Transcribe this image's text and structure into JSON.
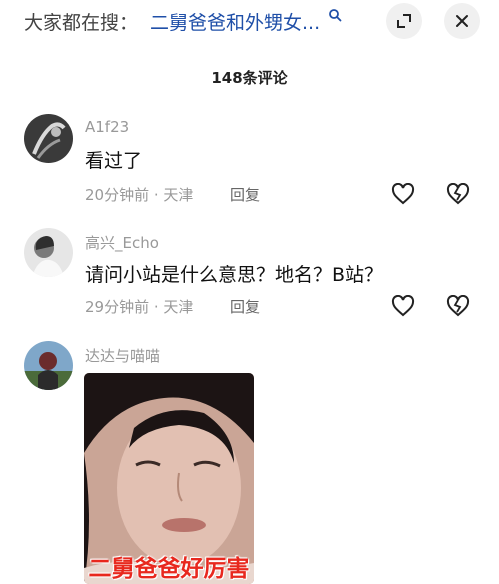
{
  "search": {
    "prefix": "大家都在搜：",
    "query": "二舅爸爸和外甥女...",
    "search_icon": "search-icon"
  },
  "toolbar": {
    "expand_icon": "expand-icon",
    "close_icon": "close-icon"
  },
  "comments_header": {
    "count_label": "148条评论"
  },
  "comments": [
    {
      "username": "A1f23",
      "text": "看过了",
      "time": "20分钟前",
      "location": "天津",
      "reply_label": "回复"
    },
    {
      "username": "高兴_Echo",
      "text": "请问小站是什么意思？地名？B站？",
      "time": "29分钟前",
      "location": "天津",
      "reply_label": "回复"
    },
    {
      "username": "达达与喵喵",
      "image_caption": "二舅爸爸好厉害"
    }
  ],
  "colors": {
    "link_blue": "#1f4fa8",
    "caption_red": "#e8281e",
    "meta_gray": "#999999"
  }
}
